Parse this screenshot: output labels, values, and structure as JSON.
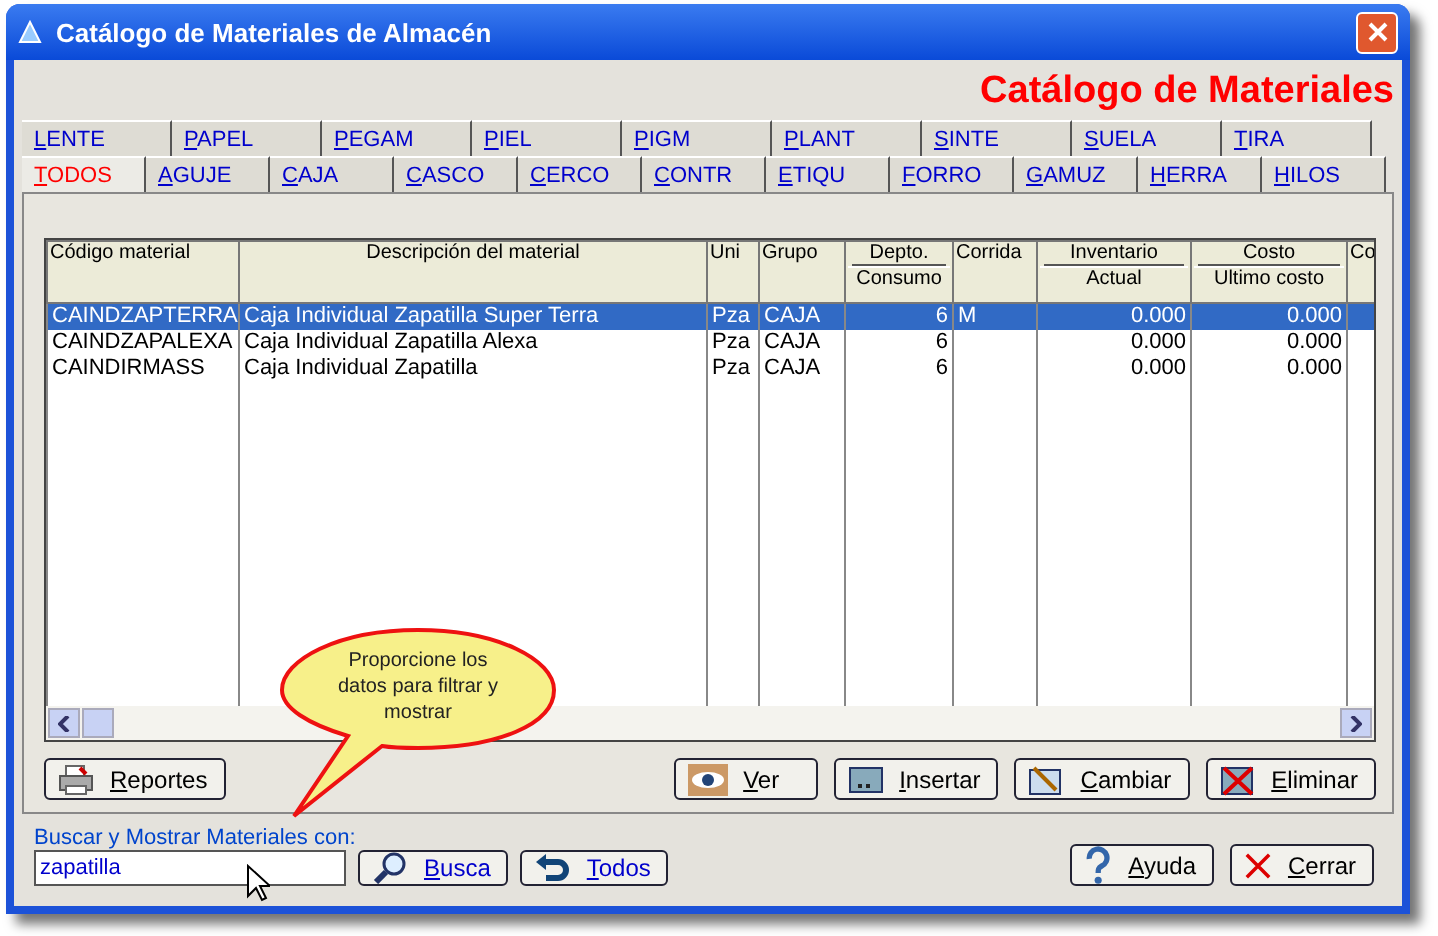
{
  "window": {
    "title": "Catálogo de Materiales de Almacén"
  },
  "heading": "Catálogo de Materiales",
  "tab_rows": [
    [
      {
        "label": "LENTE",
        "selected": false
      },
      {
        "label": "PAPEL",
        "selected": false
      },
      {
        "label": "PEGAM",
        "selected": false
      },
      {
        "label": "PIEL",
        "selected": false
      },
      {
        "label": "PIGM",
        "selected": false
      },
      {
        "label": "PLANT",
        "selected": false
      },
      {
        "label": "SINTE",
        "selected": false
      },
      {
        "label": "SUELA",
        "selected": false
      },
      {
        "label": "TIRA",
        "selected": false
      }
    ],
    [
      {
        "label": "TODOS",
        "selected": true
      },
      {
        "label": "AGUJE",
        "selected": false
      },
      {
        "label": "CAJA",
        "selected": false
      },
      {
        "label": "CASCO",
        "selected": false
      },
      {
        "label": "CERCO",
        "selected": false
      },
      {
        "label": "CONTR",
        "selected": false
      },
      {
        "label": "ETIQU",
        "selected": false
      },
      {
        "label": "FORRO",
        "selected": false
      },
      {
        "label": "GAMUZ",
        "selected": false
      },
      {
        "label": "HERRA",
        "selected": false
      },
      {
        "label": "HILOS",
        "selected": false
      }
    ]
  ],
  "table": {
    "columns": [
      {
        "label": "Código material"
      },
      {
        "label": "Descripción del material"
      },
      {
        "label": "Uni"
      },
      {
        "label": "Grupo"
      },
      {
        "group": "Depto.",
        "label": "Consumo"
      },
      {
        "label": "Corrida"
      },
      {
        "group": "Inventario",
        "label": "Actual"
      },
      {
        "group": "Costo",
        "label": "Ultimo costo"
      },
      {
        "label": "Co"
      }
    ],
    "rows": [
      {
        "selected": true,
        "cells": [
          "CAINDZAPTERRA",
          "Caja Individual Zapatilla Super Terra",
          "Pza",
          "CAJA",
          "6",
          "M",
          "0.000",
          "0.000"
        ]
      },
      {
        "selected": false,
        "cells": [
          "CAINDZAPALEXA",
          "Caja Individual Zapatilla Alexa",
          "Pza",
          "CAJA",
          "6",
          "",
          "0.000",
          "0.000"
        ]
      },
      {
        "selected": false,
        "cells": [
          "CAINDIRMASS",
          "Caja Individual Zapatilla",
          "Pza",
          "CAJA",
          "6",
          "",
          "0.000",
          "0.000"
        ]
      }
    ]
  },
  "actions": [
    {
      "label": "Reportes",
      "kind": "printer"
    },
    {
      "label": "Ver",
      "kind": "eye"
    },
    {
      "label": "Insertar",
      "kind": "insert"
    },
    {
      "label": "Cambiar",
      "kind": "edit"
    },
    {
      "label": "Eliminar",
      "kind": "delete"
    }
  ],
  "search": {
    "label": "Buscar y Mostrar Materiales con:",
    "value": "zapatilla",
    "buttons": [
      {
        "label": "Busca",
        "kind": "search"
      },
      {
        "label": "Todos",
        "kind": "undo"
      }
    ]
  },
  "footer_buttons": [
    {
      "label": "Ayuda",
      "kind": "help"
    },
    {
      "label": "Cerrar",
      "kind": "close"
    }
  ],
  "tooltip": "Proporcione los datos para filtrar y mostrar"
}
